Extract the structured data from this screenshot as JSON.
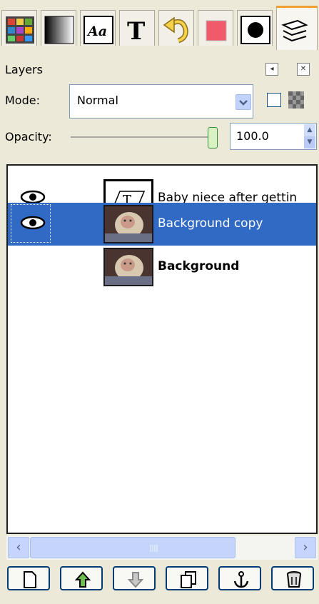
{
  "tabs": [
    {
      "icon": "palette-grid-icon"
    },
    {
      "icon": "gradient-icon"
    },
    {
      "icon": "font-icon",
      "label": "Aa"
    },
    {
      "icon": "text-tool-icon",
      "label": "T"
    },
    {
      "icon": "undo-history-icon"
    },
    {
      "icon": "pattern-icon"
    },
    {
      "icon": "brush-icon"
    },
    {
      "icon": "layers-stack-icon"
    }
  ],
  "panel": {
    "title": "Layers"
  },
  "mode": {
    "label": "Mode:",
    "value": "Normal"
  },
  "opacity": {
    "label": "Opacity:",
    "value": "100.0",
    "fraction": 1.0
  },
  "layers": [
    {
      "name": "Baby niece after gettin",
      "visible": true,
      "selected": false,
      "thumb": "text-layer-icon"
    },
    {
      "name": "Background copy",
      "visible": true,
      "selected": true,
      "thumb": "photo-thumbnail"
    },
    {
      "name": "Background",
      "visible": false,
      "selected": false,
      "thumb": "photo-thumbnail"
    }
  ],
  "buttons": [
    {
      "icon": "new-layer-icon"
    },
    {
      "icon": "raise-layer-icon"
    },
    {
      "icon": "lower-layer-icon"
    },
    {
      "icon": "duplicate-layer-icon"
    },
    {
      "icon": "anchor-icon"
    },
    {
      "icon": "delete-layer-icon"
    }
  ],
  "colors": {
    "selection": "#316ac5",
    "accent": "#f0a030"
  }
}
